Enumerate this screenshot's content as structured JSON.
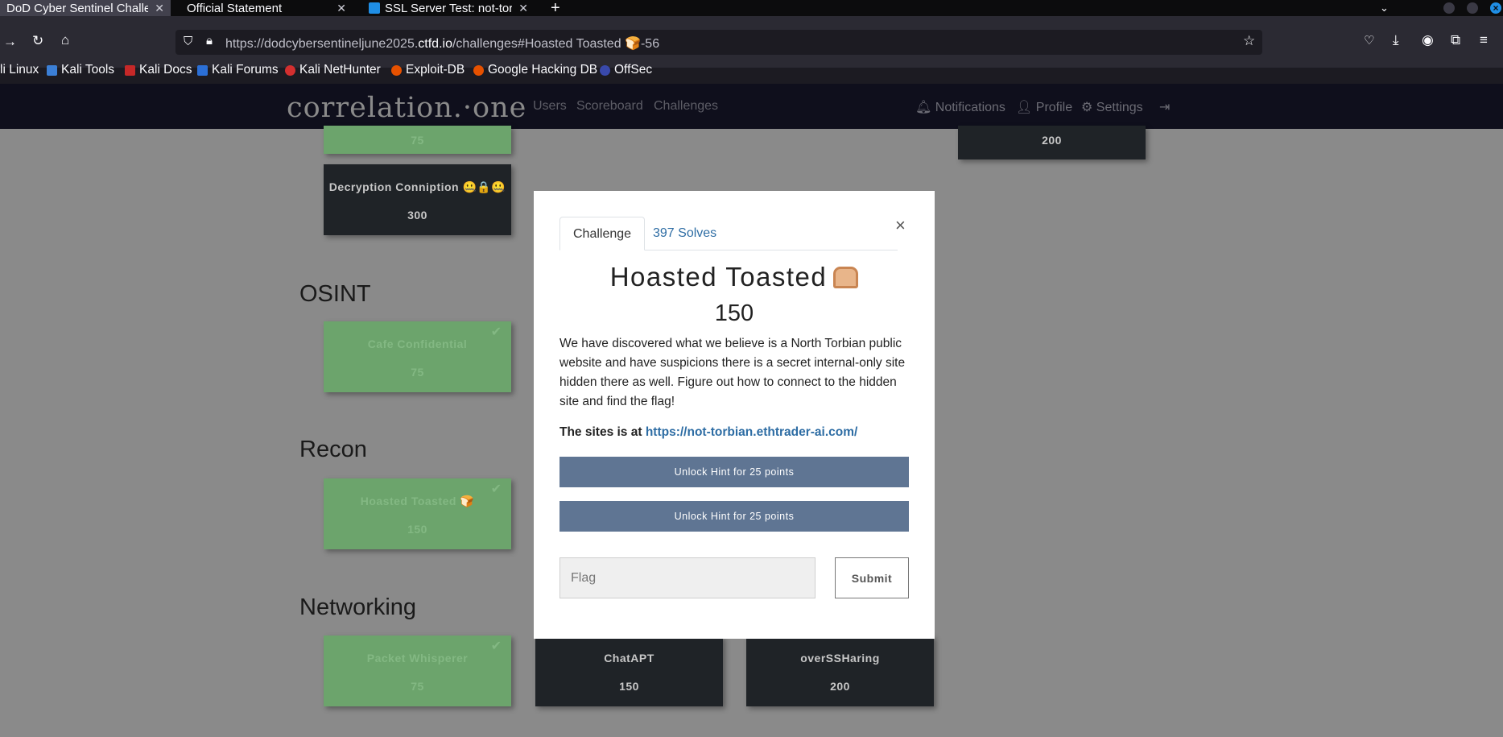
{
  "browser": {
    "tabs": [
      {
        "title": "DoD Cyber Sentinel Challeng",
        "active": true
      },
      {
        "title": "Official Statement",
        "active": false
      },
      {
        "title": "SSL Server Test: not-torbi",
        "active": false
      }
    ],
    "new_tab_label": "+",
    "url": {
      "prefix": "https://dodcybersentineljune2025.",
      "domain": "ctfd.io",
      "suffix": "/challenges#Hoasted Toasted 🍞-56"
    },
    "bookmarks": [
      "li Linux",
      "Kali Tools",
      "Kali Docs",
      "Kali Forums",
      "Kali NetHunter",
      "Exploit-DB",
      "Google Hacking DB",
      "OffSec"
    ]
  },
  "site": {
    "logo": "correlation.·one",
    "nav_left": [
      "Users",
      "Scoreboard",
      "Challenges"
    ],
    "nav_right": {
      "notifications": "Notifications",
      "profile": "Profile",
      "settings": "Settings"
    }
  },
  "board": {
    "sections": {
      "osint": "OSINT",
      "recon": "Recon",
      "networking": "Networking"
    },
    "cards": {
      "top_solved_value": "75",
      "top_right_value": "200",
      "decryption": {
        "name": "Decryption Conniption 🤐🔒🤐",
        "value": "300"
      },
      "cafe": {
        "name": "Cafe Confidential",
        "value": "75"
      },
      "hoasted": {
        "name": "Hoasted Toasted 🍞",
        "value": "150"
      },
      "packet": {
        "name": "Packet Whisperer",
        "value": "75"
      },
      "chatapt": {
        "name": "ChatAPT",
        "value": "150"
      },
      "oversshar": {
        "name": "overSSHaring",
        "value": "200"
      }
    },
    "check_glyph": "✔"
  },
  "modal": {
    "tab_challenge": "Challenge",
    "tab_solves": "397 Solves",
    "close": "×",
    "title": "Hoasted Toasted",
    "value": "150",
    "description": "We have discovered what we believe is a North Torbian public website and have suspicions there is a secret internal-only site hidden there as well. Figure out how to connect to the hidden site and find the flag!",
    "sites_label": "The sites is at",
    "sites_link": "https://not-torbian.ethtrader-ai.com/",
    "hint1": "Unlock Hint for 25 points",
    "hint2": "Unlock Hint for 25 points",
    "flag_placeholder": "Flag",
    "submit": "Submit"
  }
}
